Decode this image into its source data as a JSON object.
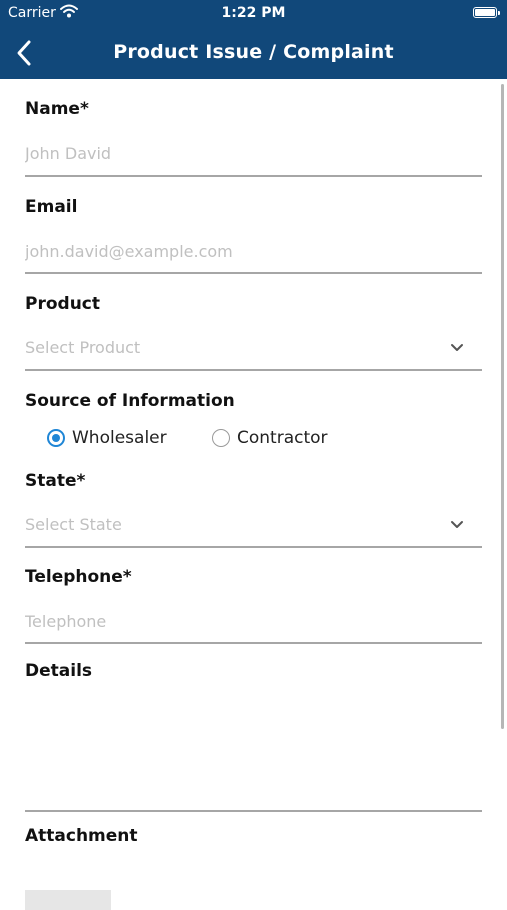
{
  "status_bar": {
    "carrier": "Carrier",
    "time": "1:22 PM"
  },
  "nav": {
    "title": "Product Issue / Complaint",
    "back_icon": "chevron-left-icon"
  },
  "form": {
    "name": {
      "label": "Name*",
      "placeholder": "John David"
    },
    "email": {
      "label": "Email",
      "placeholder": "john.david@example.com"
    },
    "product": {
      "label": "Product",
      "placeholder": "Select Product"
    },
    "source": {
      "label": "Source of Information",
      "options": [
        {
          "label": "Wholesaler",
          "selected": true
        },
        {
          "label": "Contractor",
          "selected": false
        }
      ]
    },
    "state": {
      "label": "State*",
      "placeholder": "Select State"
    },
    "telephone": {
      "label": "Telephone*",
      "placeholder": "Telephone"
    },
    "details": {
      "label": "Details"
    },
    "attachment": {
      "label": "Attachment"
    }
  },
  "colors": {
    "nav_background": "#11487a",
    "accent": "#1f86d6",
    "placeholder": "#c0c0c0",
    "underline": "#a6a6a6"
  }
}
